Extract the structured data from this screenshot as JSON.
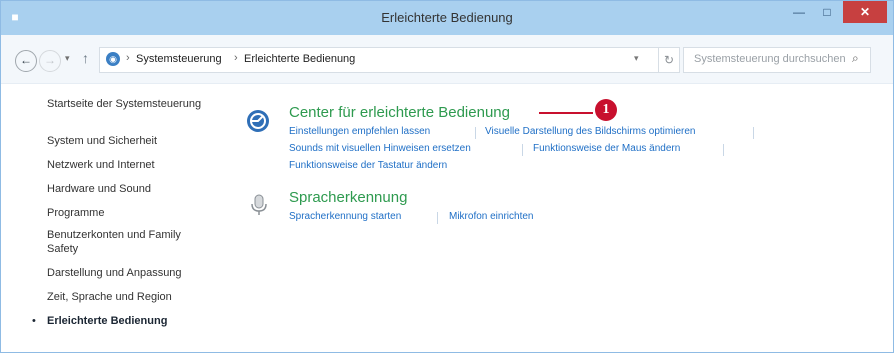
{
  "window": {
    "title": "Erleichterte Bedienung"
  },
  "toolbar": {
    "back_glyph": "←",
    "forward_glyph": "→",
    "dropdown_glyph": "▾",
    "up_glyph": "↑",
    "breadcrumbs": [
      "Systemsteuerung",
      "Erleichterte Bedienung"
    ],
    "breadcrumb_separator": "›",
    "refresh_glyph": "↻",
    "search_placeholder": "Systemsteuerung durchsuchen"
  },
  "sidebar": {
    "home": "Startseite der Systemsteuerung",
    "items": [
      {
        "label": "System und Sicherheit"
      },
      {
        "label": "Netzwerk und Internet"
      },
      {
        "label": "Hardware und Sound"
      },
      {
        "label": "Programme"
      },
      {
        "label": "Benutzerkonten und Family Safety"
      },
      {
        "label": "Darstellung und Anpassung"
      },
      {
        "label": "Zeit, Sprache und Region"
      },
      {
        "label": "Erleichterte Bedienung",
        "active": true
      }
    ]
  },
  "categories": [
    {
      "title": "Center für erleichterte Bedienung",
      "links": [
        "Einstellungen empfehlen lassen",
        "Visuelle Darstellung des Bildschirms optimieren",
        "Sounds mit visuellen Hinweisen ersetzen",
        "Funktionsweise der Maus ändern",
        "Funktionsweise der Tastatur ändern"
      ]
    },
    {
      "title": "Spracherkennung",
      "links": [
        "Spracherkennung starten",
        "Mikrofon einrichten"
      ]
    }
  ],
  "callout": {
    "number": "1"
  },
  "colors": {
    "accent_green": "#2e9a4f",
    "link_blue": "#1f6fc6",
    "titlebar": "#a9d0ef",
    "callout_red": "#c8102e"
  }
}
